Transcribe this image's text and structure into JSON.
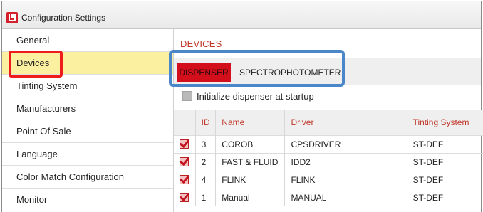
{
  "window": {
    "title": "Configuration Settings"
  },
  "sidebar": {
    "items": [
      {
        "label": "General"
      },
      {
        "label": "Devices"
      },
      {
        "label": "Tinting System"
      },
      {
        "label": "Manufacturers"
      },
      {
        "label": "Point Of Sale"
      },
      {
        "label": "Language"
      },
      {
        "label": "Color Match Configuration"
      },
      {
        "label": "Monitor"
      }
    ],
    "selected": "Devices"
  },
  "main": {
    "section_title": "DEVICES",
    "tabs": [
      {
        "label": "DISPENSER",
        "active": true
      },
      {
        "label": "SPECTROPHOTOMETER",
        "active": false
      }
    ],
    "init_option": {
      "label": "Initialize dispenser at startup",
      "checked": false
    },
    "table": {
      "headers": [
        "ID",
        "Name",
        "Driver",
        "Tinting System"
      ],
      "rows": [
        {
          "checked": true,
          "id": "3",
          "name": "COROB",
          "driver": "CPSDRIVER",
          "tinting_system": "ST-DEF"
        },
        {
          "checked": true,
          "id": "2",
          "name": "FAST & FLUID",
          "driver": "IDD2",
          "tinting_system": "ST-DEF"
        },
        {
          "checked": true,
          "id": "4",
          "name": "FLINK",
          "driver": "FLINK",
          "tinting_system": "ST-DEF"
        },
        {
          "checked": true,
          "id": "1",
          "name": "Manual",
          "driver": "MANUAL",
          "tinting_system": "ST-DEF"
        }
      ]
    }
  },
  "colors": {
    "accent_red": "#d40f1c",
    "header_text": "#c0392b",
    "selected_row": "#fbefa0",
    "annotation_red": "#ee1c1c",
    "annotation_blue": "#4a86c8"
  }
}
